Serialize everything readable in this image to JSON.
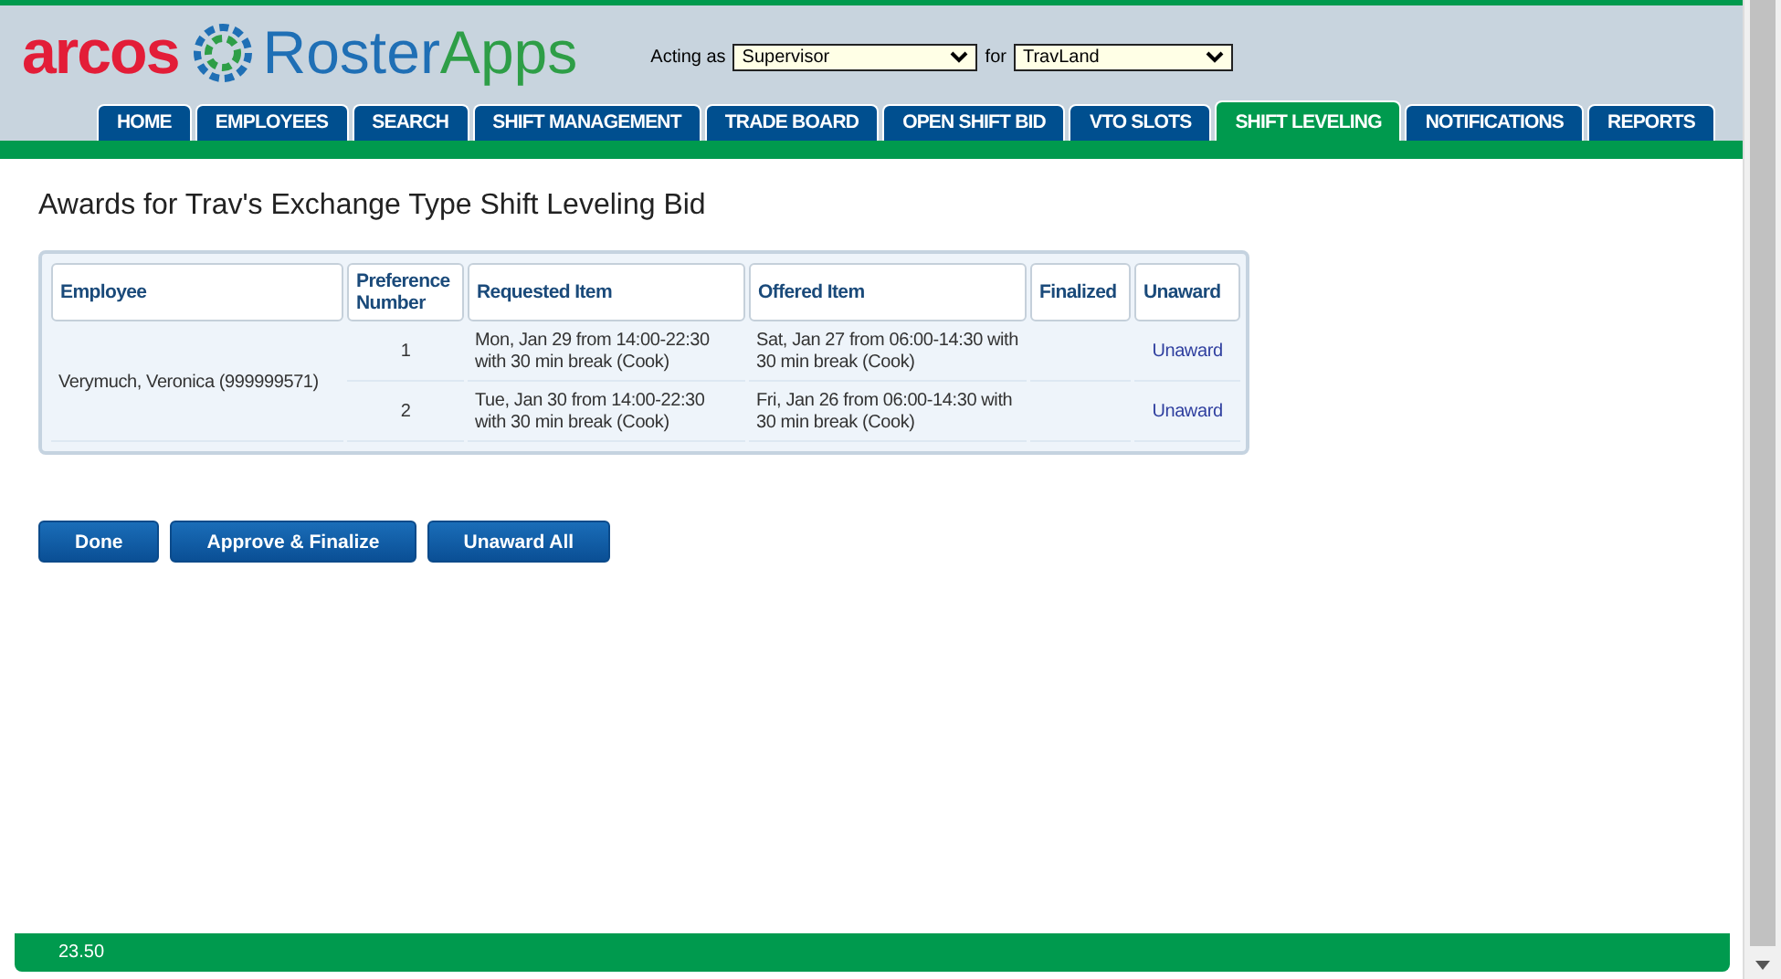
{
  "header": {
    "brand": "arcos",
    "product": "RosterApps",
    "acting_label": "Acting as",
    "role": "Supervisor",
    "for_label": "for",
    "location": "TravLand"
  },
  "tabs": [
    {
      "label": "HOME",
      "selected": false
    },
    {
      "label": "EMPLOYEES",
      "selected": false
    },
    {
      "label": "SEARCH",
      "selected": false
    },
    {
      "label": "SHIFT MANAGEMENT",
      "selected": false
    },
    {
      "label": "TRADE BOARD",
      "selected": false
    },
    {
      "label": "OPEN SHIFT BID",
      "selected": false
    },
    {
      "label": "VTO SLOTS",
      "selected": false
    },
    {
      "label": "SHIFT LEVELING",
      "selected": true
    },
    {
      "label": "NOTIFICATIONS",
      "selected": false
    },
    {
      "label": "REPORTS",
      "selected": false
    }
  ],
  "page_title": "Awards for Trav's Exchange Type Shift Leveling Bid",
  "table": {
    "columns": [
      "Employee",
      "Preference Number",
      "Requested Item",
      "Offered Item",
      "Finalized",
      "Unaward"
    ],
    "groups": [
      {
        "employee": "Verymuch, Veronica (999999571)",
        "rows": [
          {
            "preference": "1",
            "requested": "Mon, Jan 29 from 14:00-22:30 with 30 min break (Cook)",
            "offered": "Sat, Jan 27 from 06:00-14:30 with 30 min break (Cook)",
            "action": "Unaward"
          },
          {
            "preference": "2",
            "requested": "Tue, Jan 30 from 14:00-22:30 with 30 min break (Cook)",
            "offered": "Fri, Jan 26 from 06:00-14:30 with 30 min break (Cook)",
            "action": "Unaward"
          }
        ]
      }
    ]
  },
  "buttons": [
    "Done",
    "Approve & Finalize",
    "Unaward All"
  ],
  "status_bar": {
    "version": "23.50"
  }
}
